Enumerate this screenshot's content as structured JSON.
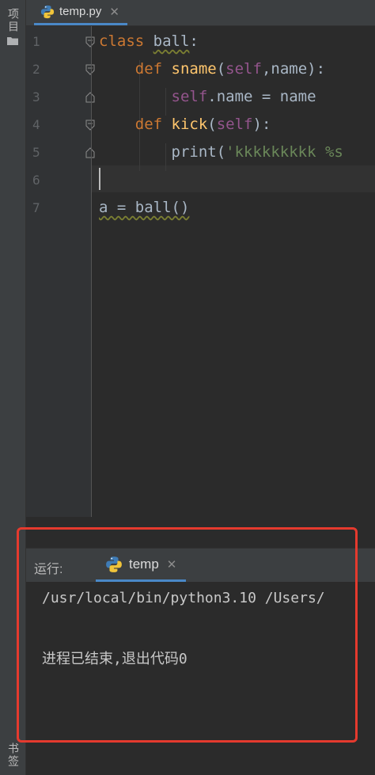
{
  "sidebar": {
    "project_label": "项目",
    "bookmarks_label": "书签"
  },
  "tab": {
    "label": "temp.py"
  },
  "editor": {
    "line_numbers": [
      "1",
      "2",
      "3",
      "4",
      "5",
      "6",
      "7"
    ],
    "lines": [
      [
        {
          "t": "class ",
          "c": "kw"
        },
        {
          "t": "ball",
          "c": "wavy"
        },
        {
          "t": ":",
          "c": ""
        }
      ],
      [
        {
          "t": "    def ",
          "c": "kw"
        },
        {
          "t": "sname",
          "c": "fn"
        },
        {
          "t": "(",
          "c": ""
        },
        {
          "t": "self",
          "c": "self"
        },
        {
          "t": ",",
          "c": ""
        },
        {
          "t": "name",
          "c": ""
        },
        {
          "t": "):",
          "c": ""
        }
      ],
      [
        {
          "t": "        ",
          "c": ""
        },
        {
          "t": "self",
          "c": "self"
        },
        {
          "t": ".name = name",
          "c": ""
        }
      ],
      [
        {
          "t": "    def ",
          "c": "kw"
        },
        {
          "t": "kick",
          "c": "fn"
        },
        {
          "t": "(",
          "c": ""
        },
        {
          "t": "self",
          "c": "self"
        },
        {
          "t": "):",
          "c": ""
        }
      ],
      [
        {
          "t": "        print(",
          "c": ""
        },
        {
          "t": "'kkkkkkkkk %s",
          "c": "str"
        }
      ],
      [],
      [
        {
          "t": "a = ball()",
          "c": "wavy"
        }
      ]
    ]
  },
  "run": {
    "label": "运行:",
    "tab_label": "temp",
    "command": "/usr/local/bin/python3.10 /Users/",
    "exit_message": "进程已结束,退出代码0"
  }
}
